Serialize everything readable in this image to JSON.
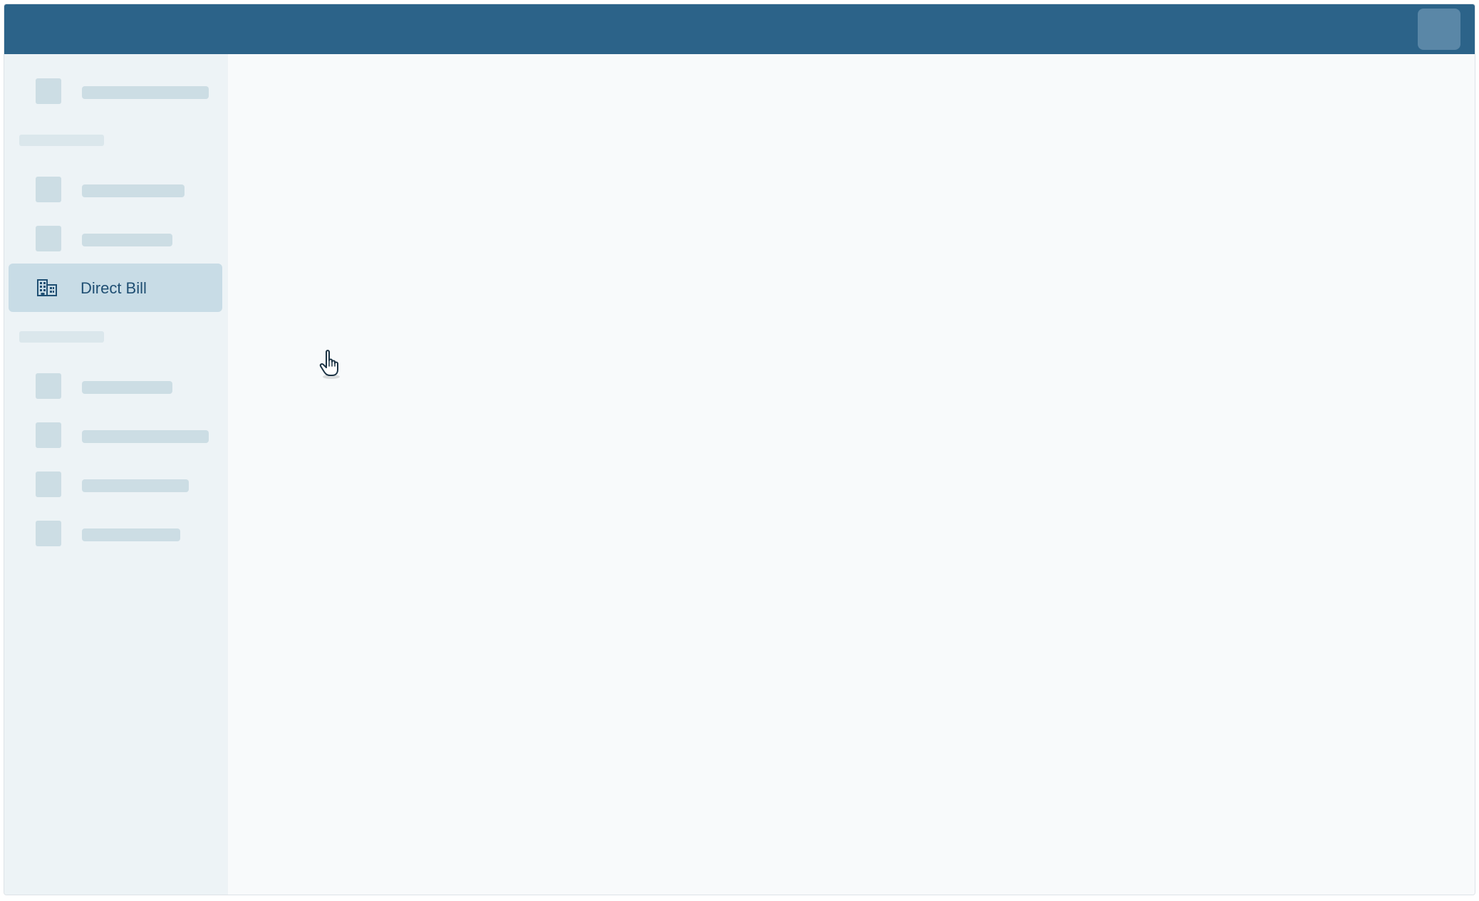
{
  "sidebar": {
    "active_item": {
      "label": "Direct Bill",
      "icon": "building-icon"
    }
  },
  "colors": {
    "topbar": "#2c6389",
    "sidebar_bg": "#edf3f6",
    "active_bg": "#c8dce6",
    "active_text": "#1f4f73",
    "placeholder": "#ccdde4",
    "main_bg": "#f8fafb"
  }
}
